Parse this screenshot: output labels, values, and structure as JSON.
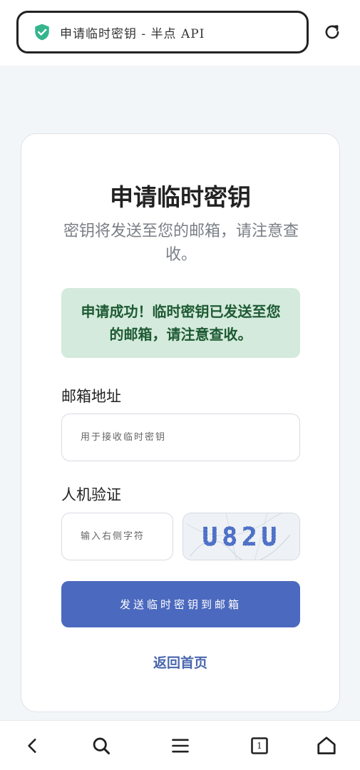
{
  "browser": {
    "url_text": "申请临时密钥 - 半点 API",
    "tab_count": "1"
  },
  "card": {
    "title": "申请临时密钥",
    "subtitle": "密钥将发送至您的邮箱，请注意查收。",
    "alert": "申请成功！临时密钥已发送至您的邮箱，请注意查收。",
    "email_label": "邮箱地址",
    "email_placeholder": "用于接收临时密钥",
    "captcha_label": "人机验证",
    "captcha_placeholder": "输入右侧字符",
    "captcha_code": "U82U",
    "submit_label": "发送临时密钥到邮箱",
    "back_label": "返回首页"
  },
  "colors": {
    "accent": "#4b69be",
    "success_bg": "#d4eadc",
    "success_text": "#1d5a33",
    "shield": "#35b58b"
  }
}
